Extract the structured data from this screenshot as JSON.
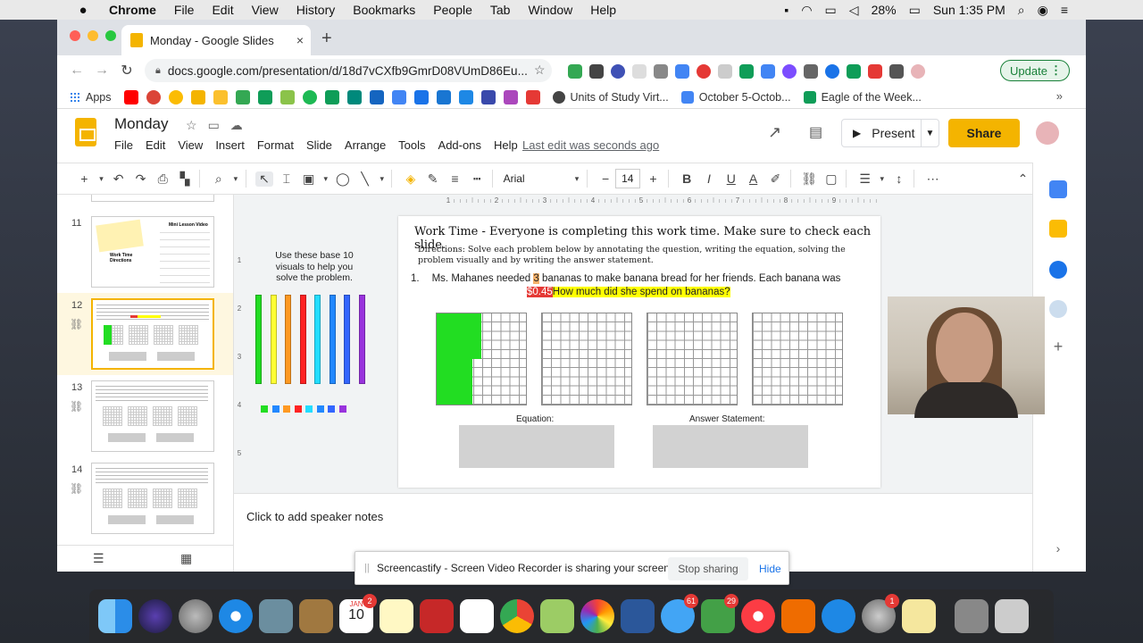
{
  "macmenu": {
    "apple": "",
    "app": "Chrome",
    "items": [
      "File",
      "Edit",
      "View",
      "History",
      "Bookmarks",
      "People",
      "Tab",
      "Window",
      "Help"
    ],
    "battery": "28%",
    "clock": "Sun 1:35 PM"
  },
  "browser": {
    "tab_title": "Monday - Google Slides",
    "tab_close": "×",
    "new_tab": "+",
    "url": "docs.google.com/presentation/d/18d7vCXfb9GmrD08VUmD86Eu...",
    "update_label": "Update",
    "update_more": "⋮",
    "bookmarks": {
      "apps_label": "Apps",
      "links": [
        "Units of Study Virt...",
        "October 5-Octob...",
        "Eagle of the Week..."
      ],
      "more": "»"
    }
  },
  "slides": {
    "doc_title": "Monday",
    "menus": [
      "File",
      "Edit",
      "View",
      "Insert",
      "Format",
      "Slide",
      "Arrange",
      "Tools",
      "Add-ons",
      "Help"
    ],
    "last_edit": "Last edit was seconds ago",
    "present_label": "Present",
    "share_label": "Share",
    "toolbar": {
      "font": "Arial",
      "font_size": "14"
    },
    "thumb_numbers": [
      "11",
      "12",
      "13",
      "14"
    ],
    "thumb11_text": [
      "Mini Lesson Video",
      "Work Time",
      "Directions"
    ],
    "slide": {
      "title": "Work Time - Everyone is completing this work time. Make sure to check each slide.",
      "directions": "Directions: Solve each problem below by annotating the question, writing the equation, solving the problem visually and by writing the answer statement.",
      "problem_num": "1.",
      "problem_a": "Ms. Mahanes needed ",
      "problem_qty": "3",
      "problem_b": " bananas to make banana bread  for her friends. Each banana was ",
      "problem_price": "$0.45",
      "problem_q": "How much did she spend on bananas?",
      "base10": "Use these base 10 visuals to help you solve the problem.",
      "equation_label": "Equation:",
      "answer_label": "Answer Statement:",
      "grid_fill": [
        0.4,
        0,
        0,
        0
      ],
      "grid_extra_cubes": 5
    },
    "ruler_h": [
      "1",
      "2",
      "3",
      "4",
      "5",
      "6",
      "7",
      "8",
      "9"
    ],
    "ruler_v": [
      "1",
      "2",
      "3",
      "4",
      "5"
    ],
    "speaker_notes": "Click to add speaker notes",
    "rod_colors": [
      "#22dd22",
      "#ffff33",
      "#ff9922",
      "#ff2222",
      "#22ddff",
      "#2288ff",
      "#3366ff",
      "#9933dd"
    ],
    "cube_colors": [
      "#22dd22",
      "#2288ff",
      "#ff9922",
      "#ff2222",
      "#22ddff",
      "#2288ff",
      "#3366ff",
      "#9933dd"
    ]
  },
  "notification": {
    "grip": "||",
    "message": "Screencastify - Screen Video Recorder is sharing your screen.",
    "stop_label": "Stop sharing",
    "hide_label": "Hide"
  },
  "dock": {
    "calendar_month": "JAN",
    "calendar_day": "10",
    "badges": {
      "calendar": "2",
      "messages": "61",
      "facetime": "29",
      "settings": "1"
    }
  }
}
